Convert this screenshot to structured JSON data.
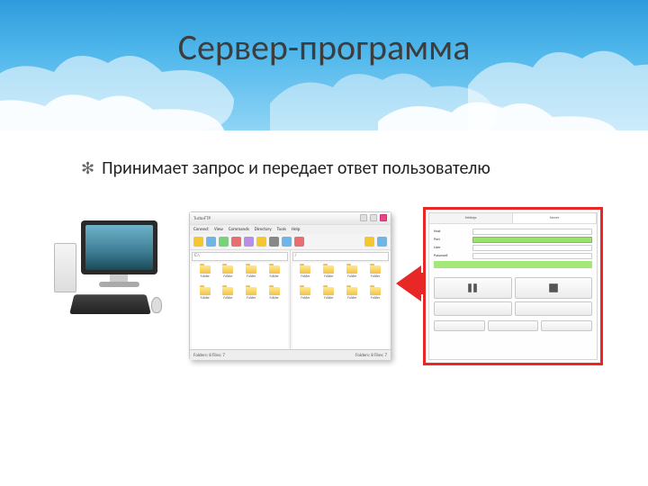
{
  "slide": {
    "title": "Сервер-программа",
    "bullet": "Принимает запрос и передает ответ пользователю"
  },
  "client_window": {
    "title": "TurboFTP",
    "menu": [
      "Connect",
      "View",
      "Commands",
      "Directory",
      "Tools",
      "Help"
    ],
    "left_path": "C:\\",
    "right_path": "/",
    "folders_left": [
      "Folder",
      "Folder",
      "Folder",
      "Folder",
      "Folder",
      "Folder",
      "Folder",
      "Folder"
    ],
    "folders_right": [
      "Folder",
      "Folder",
      "Folder",
      "Folder",
      "Folder",
      "Folder",
      "Folder",
      "Folder"
    ],
    "status_left": "Folders: 8  Files: 7",
    "status_right": "Folders: 8  Files: 7"
  },
  "server_window": {
    "tabs": [
      "Settings",
      "Server"
    ],
    "fields": {
      "host_label": "Host",
      "host_value": "",
      "port_label": "Port",
      "user_label": "User",
      "pass_label": "Password"
    }
  },
  "colors": {
    "arrow": "#e82727",
    "server_highlight": "#e82727",
    "folder": "#f2c24a",
    "green": "#9be26b"
  }
}
